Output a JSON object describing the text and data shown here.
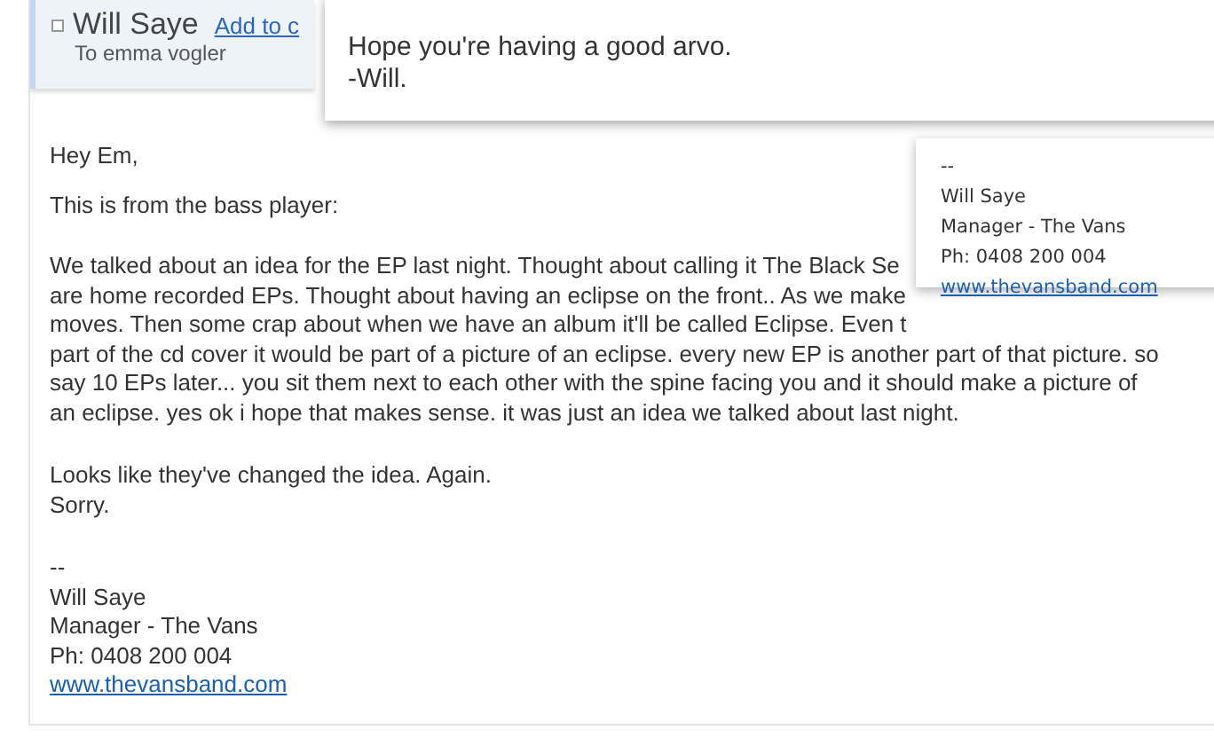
{
  "message": {
    "sender": "Will Saye",
    "add_contact": "Add to c",
    "recipient": "To emma vogler",
    "greeting": "Hey Em,",
    "intro": "This is from the bass player:",
    "paragraph_parts": [
      {
        "lines": [
          "We talked about an idea for the EP last night. Thought about calling it The Black Se",
          "are home recorded EPs. Thought about having an eclipse on the front.. As we make",
          "moves. Then some crap about when we have an album it'll be called Eclipse. Even t"
        ]
      },
      {
        "lines": [
          "part of the cd cover it would be part of a picture of an eclipse. every new EP is another part of that picture. so",
          "say 10 EPs later... you sit them next to each other with the spine facing you and it should make a picture of",
          "an eclipse. yes ok i hope that makes sense. it was just an idea we talked about last night."
        ]
      }
    ],
    "closing_lines": [
      "Looks like they've changed the idea. Again.",
      "Sorry."
    ],
    "signature": {
      "separator": "--",
      "name": "Will Saye",
      "role": "Manager - The Vans",
      "phone": "Ph: 0408 200 004",
      "website": "www.thevansband.com"
    }
  },
  "preview_popup": {
    "lines": [
      "Hope you're having a good arvo.",
      "-Will."
    ]
  },
  "signature_popup": {
    "separator": "--",
    "name": "Will Saye",
    "role": "Manager - The Vans",
    "phone": "Ph: 0408 200 004",
    "website": "www.thevansband.com"
  }
}
